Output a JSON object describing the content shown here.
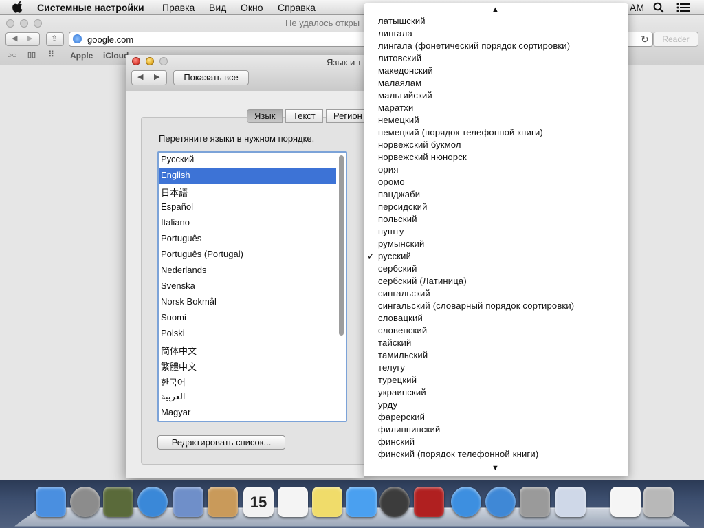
{
  "menubar": {
    "app_name": "Системные настройки",
    "items": [
      "Правка",
      "Вид",
      "Окно",
      "Справка"
    ],
    "clock_fragment": "AM"
  },
  "safari": {
    "page_title": "Не удалось откры",
    "url": "google.com",
    "reader_label": "Reader",
    "bookmarks": [
      "Apple",
      "iCloud"
    ]
  },
  "prefs": {
    "window_title_fragment": "Язык и т",
    "show_all_label": "Показать все",
    "tabs": [
      {
        "label": "Язык",
        "selected": true
      },
      {
        "label": "Текст",
        "selected": false
      },
      {
        "label": "Регион",
        "selected": false
      }
    ],
    "instruction": "Перетяните языки в нужном порядке.",
    "languages": [
      {
        "label": "Русский",
        "selected": false
      },
      {
        "label": "English",
        "selected": true
      },
      {
        "label": "日本語",
        "selected": false
      },
      {
        "label": "Español",
        "selected": false
      },
      {
        "label": "Italiano",
        "selected": false
      },
      {
        "label": "Português",
        "selected": false
      },
      {
        "label": "Português (Portugal)",
        "selected": false
      },
      {
        "label": "Nederlands",
        "selected": false
      },
      {
        "label": "Svenska",
        "selected": false
      },
      {
        "label": "Norsk Bokmål",
        "selected": false
      },
      {
        "label": "Suomi",
        "selected": false
      },
      {
        "label": "Polski",
        "selected": false
      },
      {
        "label": "简体中文",
        "selected": false
      },
      {
        "label": "繁體中文",
        "selected": false
      },
      {
        "label": "한국어",
        "selected": false
      },
      {
        "label": "العربية",
        "selected": false
      },
      {
        "label": "Magyar",
        "selected": false
      }
    ],
    "edit_list_label": "Редактировать список..."
  },
  "popup": {
    "items": [
      {
        "label": "латышский",
        "checked": false
      },
      {
        "label": "лингала",
        "checked": false
      },
      {
        "label": "лингала (фонетический порядок сортировки)",
        "checked": false
      },
      {
        "label": "литовский",
        "checked": false
      },
      {
        "label": "македонский",
        "checked": false
      },
      {
        "label": "малаялам",
        "checked": false
      },
      {
        "label": "мальтийский",
        "checked": false
      },
      {
        "label": "маратхи",
        "checked": false
      },
      {
        "label": "немецкий",
        "checked": false
      },
      {
        "label": "немецкий (порядок телефонной книги)",
        "checked": false
      },
      {
        "label": "норвежский букмол",
        "checked": false
      },
      {
        "label": "норвежский нюнорск",
        "checked": false
      },
      {
        "label": "ория",
        "checked": false
      },
      {
        "label": "оромо",
        "checked": false
      },
      {
        "label": "панджаби",
        "checked": false
      },
      {
        "label": "персидский",
        "checked": false
      },
      {
        "label": "польский",
        "checked": false
      },
      {
        "label": "пушту",
        "checked": false
      },
      {
        "label": "румынский",
        "checked": false
      },
      {
        "label": "русский",
        "checked": true
      },
      {
        "label": "сербский",
        "checked": false
      },
      {
        "label": "сербский (Латиница)",
        "checked": false
      },
      {
        "label": "сингальский",
        "checked": false
      },
      {
        "label": "сингальский (словарный порядок сортировки)",
        "checked": false
      },
      {
        "label": "словацкий",
        "checked": false
      },
      {
        "label": "словенский",
        "checked": false
      },
      {
        "label": "тайский",
        "checked": false
      },
      {
        "label": "тамильский",
        "checked": false
      },
      {
        "label": "телугу",
        "checked": false
      },
      {
        "label": "турецкий",
        "checked": false
      },
      {
        "label": "украинский",
        "checked": false
      },
      {
        "label": "урду",
        "checked": false
      },
      {
        "label": "фарерский",
        "checked": false
      },
      {
        "label": "филиппинский",
        "checked": false
      },
      {
        "label": "финский",
        "checked": false
      },
      {
        "label": "финский (порядок телефонной книги)",
        "checked": false
      }
    ],
    "check_glyph": "✓",
    "scroll_up_glyph": "▲",
    "scroll_down_glyph": "▼"
  },
  "dock": {
    "icons": [
      {
        "name": "finder-icon",
        "color": "#4a8fe0"
      },
      {
        "name": "launchpad-icon",
        "color": "#8c8c8c"
      },
      {
        "name": "mission-control-icon",
        "color": "#5a6a3a"
      },
      {
        "name": "safari-icon",
        "color": "#3a88d8"
      },
      {
        "name": "mail-icon",
        "color": "#6f8fc9"
      },
      {
        "name": "contacts-icon",
        "color": "#c99a5a"
      },
      {
        "name": "calendar-icon",
        "color": "#f2f2f2"
      },
      {
        "name": "reminders-icon",
        "color": "#f4f4f4"
      },
      {
        "name": "notes-icon",
        "color": "#f0dc6a"
      },
      {
        "name": "messages-icon",
        "color": "#4aa0f0"
      },
      {
        "name": "facetime-icon",
        "color": "#3c3c3c"
      },
      {
        "name": "photo-booth-icon",
        "color": "#b02020"
      },
      {
        "name": "itunes-icon",
        "color": "#3d8fe0"
      },
      {
        "name": "app-store-icon",
        "color": "#3f88d6"
      },
      {
        "name": "system-preferences-icon",
        "color": "#9a9a9a"
      },
      {
        "name": "wizard-icon",
        "color": "#cfd8e8"
      },
      {
        "name": "document-icon",
        "color": "#f5f5f5"
      },
      {
        "name": "trash-icon",
        "color": "#b8b8b8"
      }
    ],
    "calendar_day": "15"
  }
}
